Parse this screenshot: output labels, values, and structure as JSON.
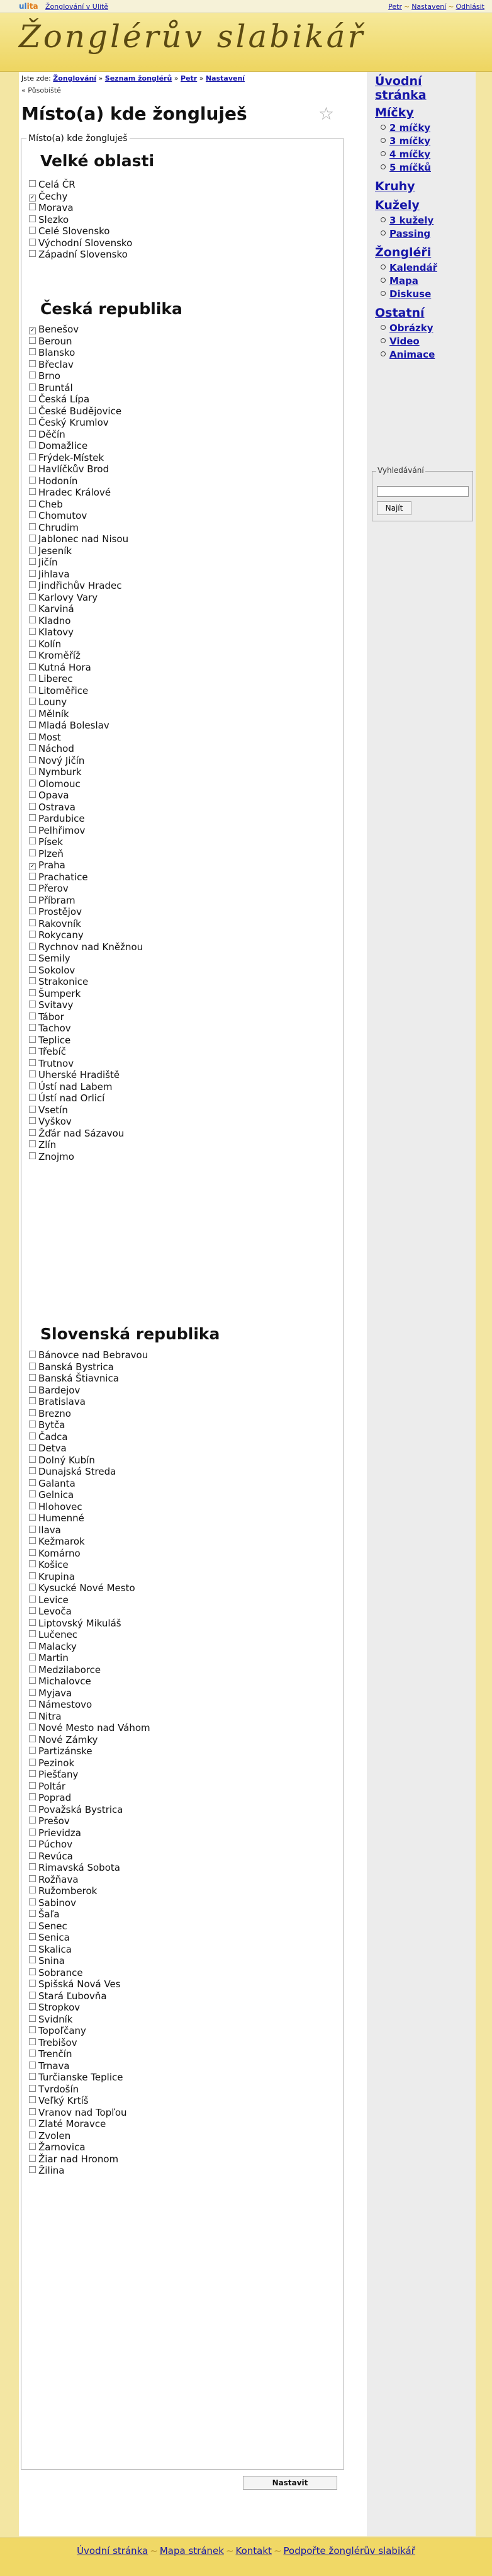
{
  "topbar": {
    "ulita_prefix": "ul",
    "ulita_suffix": "ita",
    "site_link": "Žonglování v Ulitě",
    "user_link": "Petr",
    "settings_link": "Nastavení",
    "logout_link": "Odhlásit"
  },
  "header": {
    "logo_text": "Žonglérův slabikář"
  },
  "breadcrumb": {
    "prefix": "Jste zde:",
    "items": [
      "Žonglování",
      "Seznam žonglérů",
      "Petr",
      "Nastavení"
    ]
  },
  "redirect_note": "« Působiště",
  "page_title": "Místo(a) kde žongluješ",
  "form": {
    "legend": "Místo(a) kde žongluješ",
    "submit_label": "Nastavit",
    "groups": [
      {
        "title": "Velké oblasti",
        "items": [
          {
            "label": "Celá ČR",
            "checked": false
          },
          {
            "label": "Čechy",
            "checked": true
          },
          {
            "label": "Morava",
            "checked": false
          },
          {
            "label": "Slezko",
            "checked": false
          },
          {
            "label": "Celé Slovensko",
            "checked": false
          },
          {
            "label": "Východní Slovensko",
            "checked": false
          },
          {
            "label": "Západní Slovensko",
            "checked": false
          }
        ]
      },
      {
        "title": "Česká republika",
        "items": [
          {
            "label": "Benešov",
            "checked": true
          },
          {
            "label": "Beroun",
            "checked": false
          },
          {
            "label": "Blansko",
            "checked": false
          },
          {
            "label": "Břeclav",
            "checked": false
          },
          {
            "label": "Brno",
            "checked": false
          },
          {
            "label": "Bruntál",
            "checked": false
          },
          {
            "label": "Česká Lípa",
            "checked": false
          },
          {
            "label": "České Budějovice",
            "checked": false
          },
          {
            "label": "Český Krumlov",
            "checked": false
          },
          {
            "label": "Děčín",
            "checked": false
          },
          {
            "label": "Domažlice",
            "checked": false
          },
          {
            "label": "Frýdek-Místek",
            "checked": false
          },
          {
            "label": "Havlíčkův Brod",
            "checked": false
          },
          {
            "label": "Hodonín",
            "checked": false
          },
          {
            "label": "Hradec Králové",
            "checked": false
          },
          {
            "label": "Cheb",
            "checked": false
          },
          {
            "label": "Chomutov",
            "checked": false
          },
          {
            "label": "Chrudim",
            "checked": false
          },
          {
            "label": "Jablonec nad Nisou",
            "checked": false
          },
          {
            "label": "Jeseník",
            "checked": false
          },
          {
            "label": "Jičín",
            "checked": false
          },
          {
            "label": "Jihlava",
            "checked": false
          },
          {
            "label": "Jindřichův Hradec",
            "checked": false
          },
          {
            "label": "Karlovy Vary",
            "checked": false
          },
          {
            "label": "Karviná",
            "checked": false
          },
          {
            "label": "Kladno",
            "checked": false
          },
          {
            "label": "Klatovy",
            "checked": false
          },
          {
            "label": "Kolín",
            "checked": false
          },
          {
            "label": "Kroměříž",
            "checked": false
          },
          {
            "label": "Kutná Hora",
            "checked": false
          },
          {
            "label": "Liberec",
            "checked": false
          },
          {
            "label": "Litoměřice",
            "checked": false
          },
          {
            "label": "Louny",
            "checked": false
          },
          {
            "label": "Mělník",
            "checked": false
          },
          {
            "label": "Mladá Boleslav",
            "checked": false
          },
          {
            "label": "Most",
            "checked": false
          },
          {
            "label": "Náchod",
            "checked": false
          },
          {
            "label": "Nový Jičín",
            "checked": false
          },
          {
            "label": "Nymburk",
            "checked": false
          },
          {
            "label": "Olomouc",
            "checked": false
          },
          {
            "label": "Opava",
            "checked": false
          },
          {
            "label": "Ostrava",
            "checked": false
          },
          {
            "label": "Pardubice",
            "checked": false
          },
          {
            "label": "Pelhřimov",
            "checked": false
          },
          {
            "label": "Písek",
            "checked": false
          },
          {
            "label": "Plzeň",
            "checked": false
          },
          {
            "label": "Praha",
            "checked": true
          },
          {
            "label": "Prachatice",
            "checked": false
          },
          {
            "label": "Přerov",
            "checked": false
          },
          {
            "label": "Příbram",
            "checked": false
          },
          {
            "label": "Prostějov",
            "checked": false
          },
          {
            "label": "Rakovník",
            "checked": false
          },
          {
            "label": "Rokycany",
            "checked": false
          },
          {
            "label": "Rychnov nad Kněžnou",
            "checked": false
          },
          {
            "label": "Semily",
            "checked": false
          },
          {
            "label": "Sokolov",
            "checked": false
          },
          {
            "label": "Strakonice",
            "checked": false
          },
          {
            "label": "Šumperk",
            "checked": false
          },
          {
            "label": "Svitavy",
            "checked": false
          },
          {
            "label": "Tábor",
            "checked": false
          },
          {
            "label": "Tachov",
            "checked": false
          },
          {
            "label": "Teplice",
            "checked": false
          },
          {
            "label": "Třebíč",
            "checked": false
          },
          {
            "label": "Trutnov",
            "checked": false
          },
          {
            "label": "Uherské Hradiště",
            "checked": false
          },
          {
            "label": "Ústí nad Labem",
            "checked": false
          },
          {
            "label": "Ústí nad Orlicí",
            "checked": false
          },
          {
            "label": "Vsetín",
            "checked": false
          },
          {
            "label": "Vyškov",
            "checked": false
          },
          {
            "label": "Žďár nad Sázavou",
            "checked": false
          },
          {
            "label": "Zlín",
            "checked": false
          },
          {
            "label": "Znojmo",
            "checked": false
          }
        ]
      },
      {
        "title": "Slovenská republika",
        "items": [
          {
            "label": "Bánovce nad Bebravou",
            "checked": false
          },
          {
            "label": "Banská Bystrica",
            "checked": false
          },
          {
            "label": "Banská Štiavnica",
            "checked": false
          },
          {
            "label": "Bardejov",
            "checked": false
          },
          {
            "label": "Bratislava",
            "checked": false
          },
          {
            "label": "Brezno",
            "checked": false
          },
          {
            "label": "Bytča",
            "checked": false
          },
          {
            "label": "Čadca",
            "checked": false
          },
          {
            "label": "Detva",
            "checked": false
          },
          {
            "label": "Dolný Kubín",
            "checked": false
          },
          {
            "label": "Dunajská Streda",
            "checked": false
          },
          {
            "label": "Galanta",
            "checked": false
          },
          {
            "label": "Gelnica",
            "checked": false
          },
          {
            "label": "Hlohovec",
            "checked": false
          },
          {
            "label": "Humenné",
            "checked": false
          },
          {
            "label": "Ilava",
            "checked": false
          },
          {
            "label": "Kežmarok",
            "checked": false
          },
          {
            "label": "Komárno",
            "checked": false
          },
          {
            "label": "Košice",
            "checked": false
          },
          {
            "label": "Krupina",
            "checked": false
          },
          {
            "label": "Kysucké Nové Mesto",
            "checked": false
          },
          {
            "label": "Levice",
            "checked": false
          },
          {
            "label": "Levoča",
            "checked": false
          },
          {
            "label": "Liptovský Mikuláš",
            "checked": false
          },
          {
            "label": "Lučenec",
            "checked": false
          },
          {
            "label": "Malacky",
            "checked": false
          },
          {
            "label": "Martin",
            "checked": false
          },
          {
            "label": "Medzilaborce",
            "checked": false
          },
          {
            "label": "Michalovce",
            "checked": false
          },
          {
            "label": "Myjava",
            "checked": false
          },
          {
            "label": "Námestovo",
            "checked": false
          },
          {
            "label": "Nitra",
            "checked": false
          },
          {
            "label": "Nové Mesto nad Váhom",
            "checked": false
          },
          {
            "label": "Nové Zámky",
            "checked": false
          },
          {
            "label": "Partizánske",
            "checked": false
          },
          {
            "label": "Pezinok",
            "checked": false
          },
          {
            "label": "Piešťany",
            "checked": false
          },
          {
            "label": "Poltár",
            "checked": false
          },
          {
            "label": "Poprad",
            "checked": false
          },
          {
            "label": "Považská Bystrica",
            "checked": false
          },
          {
            "label": "Prešov",
            "checked": false
          },
          {
            "label": "Prievidza",
            "checked": false
          },
          {
            "label": "Púchov",
            "checked": false
          },
          {
            "label": "Revúca",
            "checked": false
          },
          {
            "label": "Rimavská Sobota",
            "checked": false
          },
          {
            "label": "Rožňava",
            "checked": false
          },
          {
            "label": "Ružomberok",
            "checked": false
          },
          {
            "label": "Sabinov",
            "checked": false
          },
          {
            "label": "Šaľa",
            "checked": false
          },
          {
            "label": "Senec",
            "checked": false
          },
          {
            "label": "Senica",
            "checked": false
          },
          {
            "label": "Skalica",
            "checked": false
          },
          {
            "label": "Snina",
            "checked": false
          },
          {
            "label": "Sobrance",
            "checked": false
          },
          {
            "label": "Spišská Nová Ves",
            "checked": false
          },
          {
            "label": "Stará Ľubovňa",
            "checked": false
          },
          {
            "label": "Stropkov",
            "checked": false
          },
          {
            "label": "Svidník",
            "checked": false
          },
          {
            "label": "Topoľčany",
            "checked": false
          },
          {
            "label": "Trebišov",
            "checked": false
          },
          {
            "label": "Trenčín",
            "checked": false
          },
          {
            "label": "Trnava",
            "checked": false
          },
          {
            "label": "Turčianske Teplice",
            "checked": false
          },
          {
            "label": "Tvrdošín",
            "checked": false
          },
          {
            "label": "Veľký Krtíš",
            "checked": false
          },
          {
            "label": "Vranov nad Topľou",
            "checked": false
          },
          {
            "label": "Zlaté Moravce",
            "checked": false
          },
          {
            "label": "Zvolen",
            "checked": false
          },
          {
            "label": "Žarnovica",
            "checked": false
          },
          {
            "label": "Žiar nad Hronom",
            "checked": false
          },
          {
            "label": "Žilina",
            "checked": false
          }
        ]
      }
    ]
  },
  "sidebar": {
    "home": "Úvodní stránka",
    "micky": "Míčky",
    "micky_items": [
      "2 míčky",
      "3 míčky",
      "4 míčky",
      "5 míčků"
    ],
    "kruhy": "Kruhy",
    "kuzely": "Kužely",
    "kuzely_items": [
      "3 kužely",
      "Passing"
    ],
    "zongleri": "Žongléři",
    "zongleri_items": [
      "Kalendář",
      "Mapa",
      "Diskuse"
    ],
    "ostatni": "Ostatní",
    "ostatni_items": [
      "Obrázky",
      "Video",
      "Animace"
    ],
    "search_legend": "Vyhledávání",
    "search_value": "",
    "search_button": "Najít"
  },
  "footer": {
    "links": [
      "Úvodní stránka",
      "Mapa stránek",
      "Kontakt",
      "Podpořte žonglérův slabikář"
    ]
  },
  "colors": {
    "link": "#1616a8",
    "header_bg": "#eed560",
    "sidebar_bg": "#ececec",
    "separator": "#b08b24"
  }
}
